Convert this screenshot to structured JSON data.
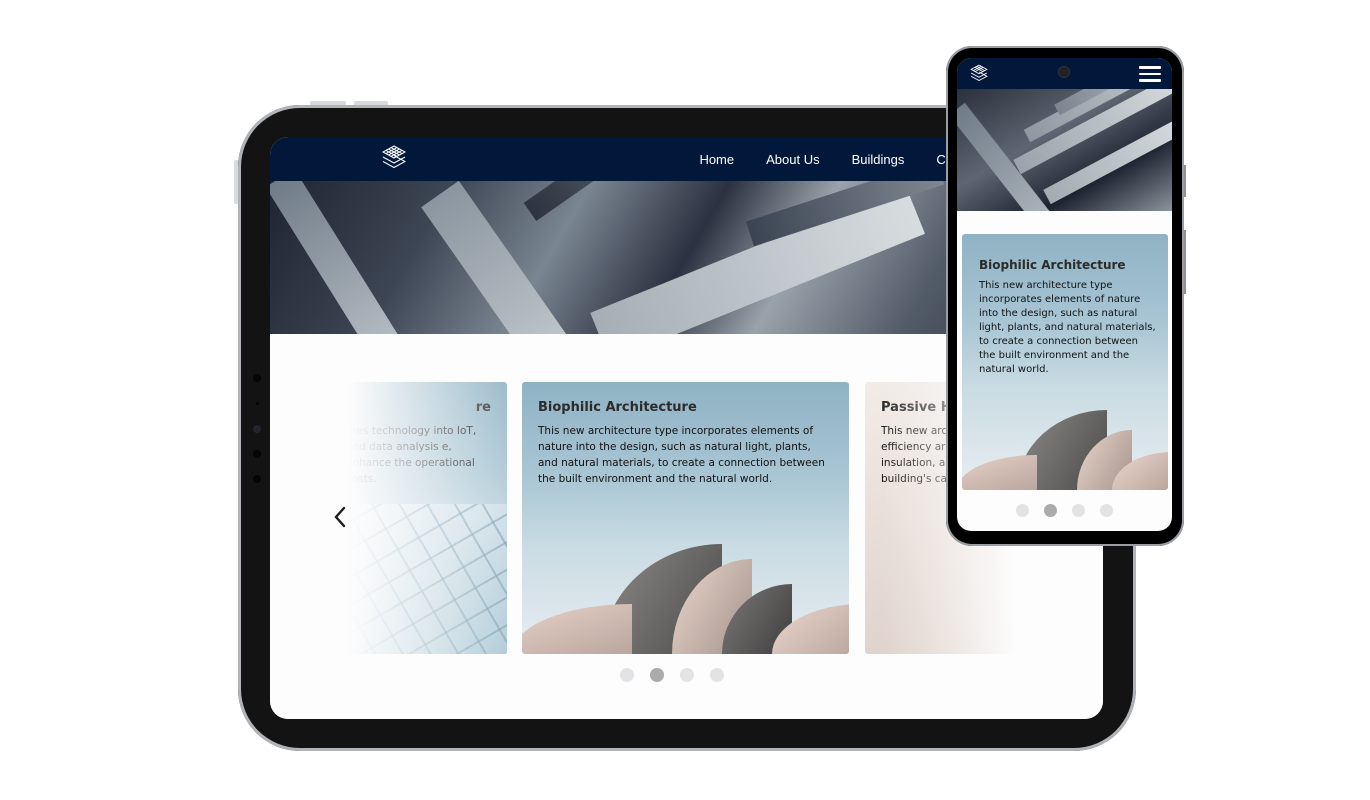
{
  "tablet": {
    "nav": {
      "logo_icon": "layers-icon",
      "items": [
        {
          "label": "Home"
        },
        {
          "label": "About Us"
        },
        {
          "label": "Buildings"
        },
        {
          "label": "Co"
        }
      ]
    },
    "carousel": {
      "prev_icon": "chevron-left-icon",
      "cards": [
        {
          "title": "re",
          "body": "ates technology into IoT, and data analysis e, enhance the operational costs."
        },
        {
          "title": "Biophilic Architecture",
          "body": "This new architecture type incorporates elements of nature into the design, such as natural light, plants, and natural materials, to create a connection between the built environment and the natural world."
        },
        {
          "title": "Passive H",
          "body": "This new arc efficiency ar insulation, a building's ca"
        }
      ],
      "dots": 4,
      "active_dot": 2
    }
  },
  "phone": {
    "nav": {
      "logo_icon": "layers-icon",
      "menu_icon": "hamburger-menu-icon"
    },
    "card": {
      "title": "Biophilic Architecture",
      "body": "This new architecture type incorporates elements of nature into the design, such as natural light, plants, and natural materials, to create a connection between the built environment and the natural world."
    },
    "dots": 4,
    "active_dot": 2
  },
  "colors": {
    "nav_bg": "#02183a",
    "dot_inactive": "#e3e3e5",
    "dot_active": "#a9abad"
  }
}
